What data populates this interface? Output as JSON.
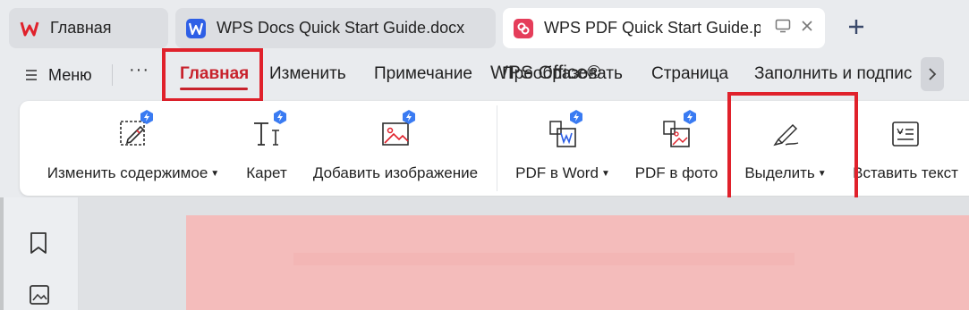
{
  "tabs": [
    {
      "label": "Главная",
      "icon": "wps-logo-icon",
      "state": "inactive"
    },
    {
      "label": "WPS Docs Quick Start Guide.docx",
      "icon": "word-doc-icon",
      "state": "inactive"
    },
    {
      "label": "WPS PDF Quick Start Guide.pdf",
      "icon": "pdf-doc-icon",
      "state": "active"
    }
  ],
  "menu": {
    "menu_label": "Меню",
    "more": "···",
    "tabs": [
      "Главная",
      "Изменить",
      "Примечание",
      "Преобразовать",
      "Страница",
      "Заполнить и подпис"
    ],
    "active_tab": "Главная"
  },
  "ribbon": {
    "buttons": [
      {
        "label": "Изменить содержимое",
        "icon": "edit-content-icon",
        "dropdown": true
      },
      {
        "label": "Карет",
        "icon": "text-cursor-icon",
        "dropdown": false
      },
      {
        "label": "Добавить изображение",
        "icon": "add-image-icon",
        "dropdown": false
      },
      {
        "label": "PDF в Word",
        "icon": "pdf-to-word-icon",
        "dropdown": true
      },
      {
        "label": "PDF в фото",
        "icon": "pdf-to-image-icon",
        "dropdown": false
      },
      {
        "label": "Выделить",
        "icon": "highlighter-icon",
        "dropdown": true
      },
      {
        "label": "Вставить текст",
        "icon": "insert-text-icon",
        "dropdown": false
      }
    ]
  },
  "document": {
    "title": "WPS Office®"
  },
  "colors": {
    "accent_red": "#c8222c",
    "annotation_red": "#e0212b",
    "premium_badge": "#3a7bf2",
    "page_bg": "#f4bcbb"
  }
}
